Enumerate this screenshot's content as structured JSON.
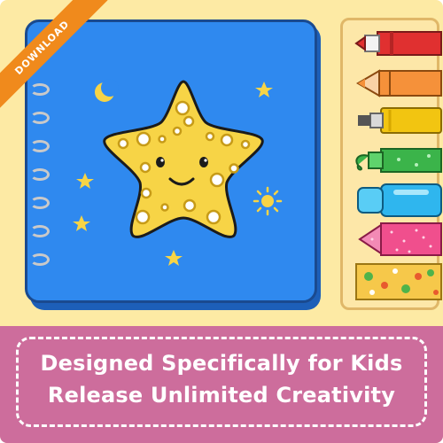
{
  "badge": {
    "label": "DOWNLOAD"
  },
  "taglines": [
    "Designed Specifically for Kids",
    "Release Unlimited Creativity"
  ],
  "colors": {
    "background": "#fdeaa4",
    "book": "#2f89ef",
    "star": "#f7d446",
    "banner": "#cd6d9c",
    "ribbon": "#f08a1c"
  },
  "icons": [
    "crescent-moon-icon",
    "sun-icon",
    "sparkle-star-icon",
    "marker-icon",
    "crayon-icon",
    "paint-tube-icon",
    "glitter-pen-icon",
    "gel-pen-icon",
    "tape-icon"
  ]
}
